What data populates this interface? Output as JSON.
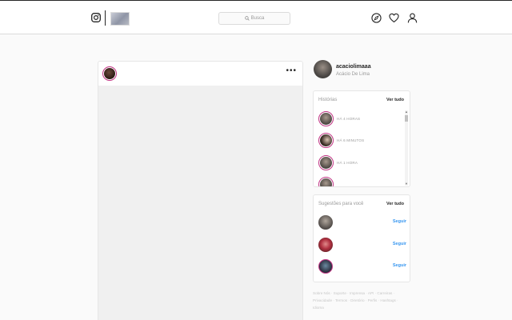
{
  "header": {
    "search_placeholder": "Busca",
    "icons": [
      "instagram-logo-icon",
      "compass-icon",
      "heart-icon",
      "profile-icon"
    ]
  },
  "profile": {
    "username": "acaciolimaaa",
    "full_name": "Acácio De Lima"
  },
  "stories": {
    "title": "Histórias",
    "see_all": "Ver tudo",
    "items": [
      {
        "time": "HÁ 4 HORAS"
      },
      {
        "time": "HÁ 6 MINUTOS"
      },
      {
        "time": "HÁ 1 HORA"
      }
    ]
  },
  "suggestions": {
    "title": "Sugestões para você",
    "see_all": "Ver tudo",
    "follow_label": "Seguir"
  },
  "footer": {
    "lines": [
      "Sobre Nós · Suporte · Imprensa · API · Carreiras ·",
      "Privacidade · Termos · Diretório · Perfis · Hashtags ·",
      "Idioma"
    ]
  },
  "colors": {
    "accent_link": "#3897f0",
    "story_ring": "#c13584",
    "border": "#dbdbdb",
    "background": "#fafafa"
  }
}
